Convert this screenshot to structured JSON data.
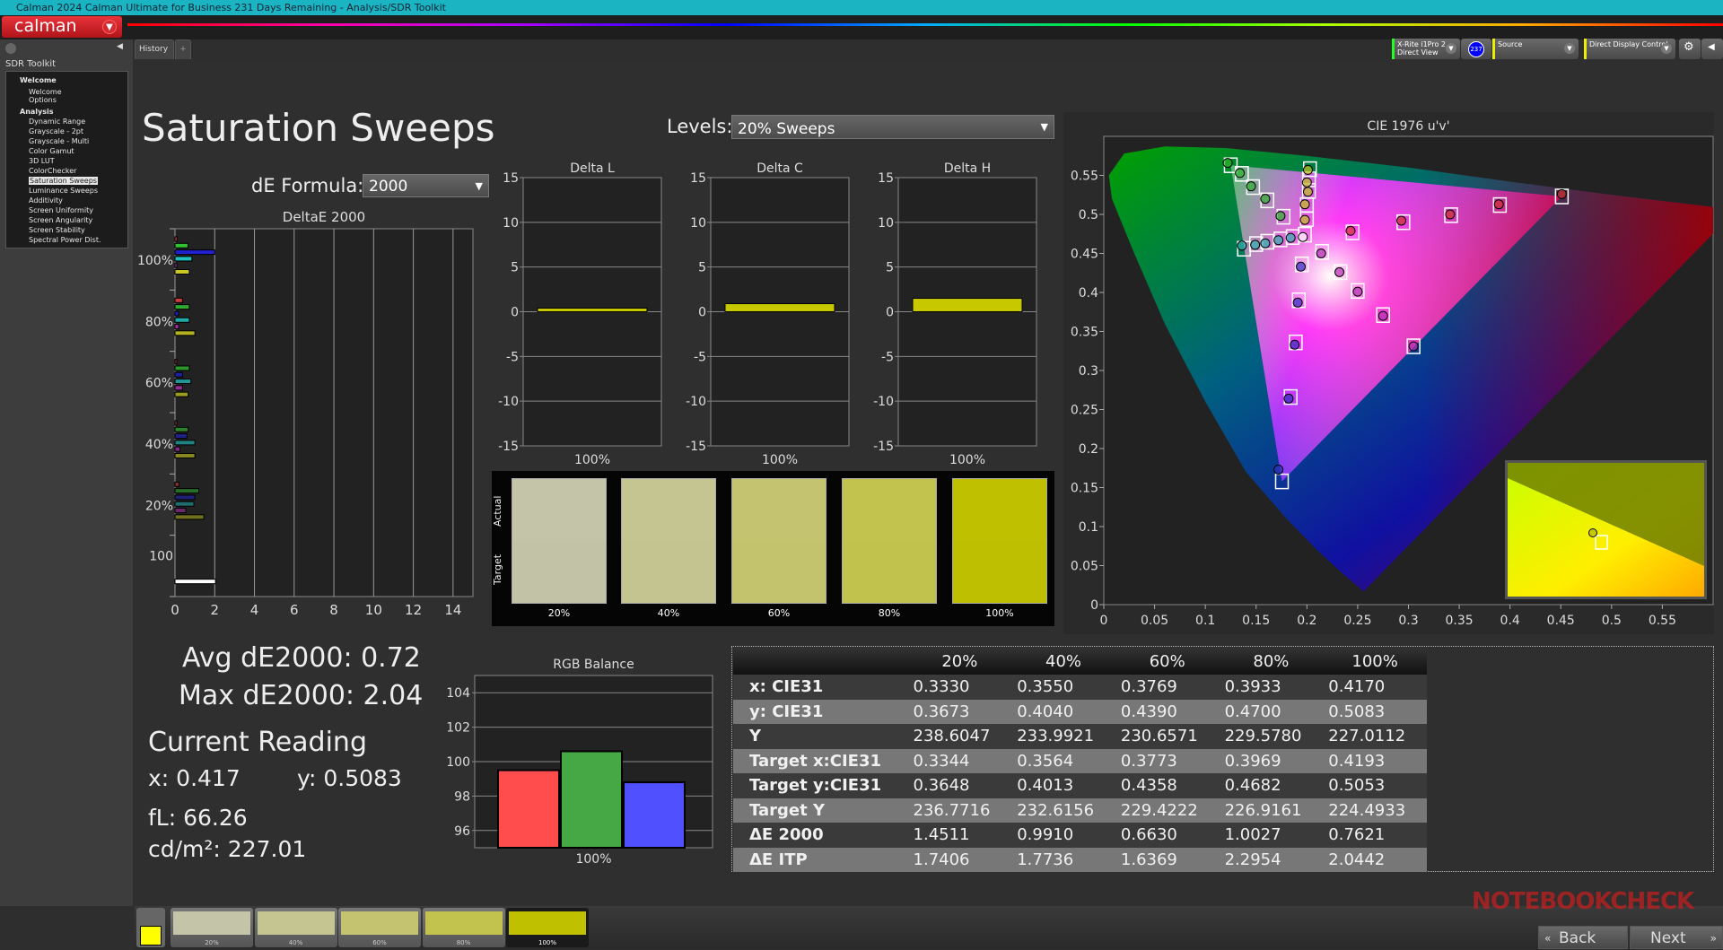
{
  "window": {
    "title": "Calman 2024 Calman Ultimate for Business 231 Days Remaining  - Analysis/SDR Toolkit",
    "logo": "calman"
  },
  "sidebar": {
    "title": "SDR Toolkit",
    "items": [
      {
        "label": "Welcome",
        "group": true
      },
      {
        "label": "Welcome"
      },
      {
        "label": "Options"
      },
      {
        "label": "Analysis",
        "group": true
      },
      {
        "label": "Dynamic Range"
      },
      {
        "label": "Grayscale - 2pt"
      },
      {
        "label": "Grayscale - Multi"
      },
      {
        "label": "Color Gamut"
      },
      {
        "label": "3D LUT"
      },
      {
        "label": "ColorChecker"
      },
      {
        "label": "Saturation Sweeps",
        "selected": true
      },
      {
        "label": "Luminance Sweeps"
      },
      {
        "label": "Additivity"
      },
      {
        "label": "Screen Uniformity"
      },
      {
        "label": "Screen Angularity"
      },
      {
        "label": "Screen Stability"
      },
      {
        "label": "Spectral Power Dist."
      }
    ]
  },
  "tabs": [
    {
      "label": "History 1"
    },
    {
      "label": "+"
    }
  ],
  "devices": {
    "meter_line1": "X-Rite i1Pro 2",
    "meter_line2": "Direct View",
    "meter_badge": "237",
    "source": "Source",
    "display": "Direct Display Control"
  },
  "page": {
    "title": "Saturation Sweeps",
    "de_formula_label": "dE Formula:",
    "de_formula_value": "2000",
    "levels_label": "Levels:",
    "levels_value": "20% Sweeps"
  },
  "summary": {
    "avg": "Avg dE2000: 0.72",
    "max": "Max dE2000: 2.04",
    "current_reading": "Current Reading",
    "x": "x: 0.417",
    "y": "y: 0.5083",
    "fl": "fL: 66.26",
    "cdm2": "cd/m²: 227.01"
  },
  "swatches": {
    "actual_label": "Actual",
    "target_label": "Target",
    "items": [
      {
        "label": "20%",
        "actual": "#c3c4a8",
        "target": "#c2c3a6"
      },
      {
        "label": "40%",
        "actual": "#c4c591",
        "target": "#c3c48f"
      },
      {
        "label": "60%",
        "actual": "#c4c470",
        "target": "#c3c36e"
      },
      {
        "label": "80%",
        "actual": "#c2c24f",
        "target": "#c1c14d"
      },
      {
        "label": "100%",
        "actual": "#bfc000",
        "target": "#bebf00"
      }
    ]
  },
  "table": {
    "columns": [
      "20%",
      "40%",
      "60%",
      "80%",
      "100%"
    ],
    "rows": [
      {
        "label": "x: CIE31",
        "values": [
          "0.3330",
          "0.3550",
          "0.3769",
          "0.3933",
          "0.4170"
        ]
      },
      {
        "label": "y: CIE31",
        "values": [
          "0.3673",
          "0.4040",
          "0.4390",
          "0.4700",
          "0.5083"
        ]
      },
      {
        "label": "Y",
        "values": [
          "238.6047",
          "233.9921",
          "230.6571",
          "229.5780",
          "227.0112"
        ]
      },
      {
        "label": "Target x:CIE31",
        "values": [
          "0.3344",
          "0.3564",
          "0.3773",
          "0.3969",
          "0.4193"
        ]
      },
      {
        "label": "Target y:CIE31",
        "values": [
          "0.3648",
          "0.4013",
          "0.4358",
          "0.4682",
          "0.5053"
        ]
      },
      {
        "label": "Target Y",
        "values": [
          "236.7716",
          "232.6156",
          "229.4222",
          "226.9161",
          "224.4933"
        ]
      },
      {
        "label": "ΔE 2000",
        "values": [
          "1.4511",
          "0.9910",
          "0.6630",
          "1.0027",
          "0.7621"
        ]
      },
      {
        "label": "ΔE ITP",
        "values": [
          "1.7406",
          "1.7736",
          "1.6369",
          "2.2954",
          "2.0442"
        ]
      }
    ]
  },
  "bottom": {
    "thumbs": [
      {
        "label": "20%",
        "color": "#c3c4a8"
      },
      {
        "label": "40%",
        "color": "#c4c591"
      },
      {
        "label": "60%",
        "color": "#c4c470"
      },
      {
        "label": "80%",
        "color": "#c2c24f"
      },
      {
        "label": "100%",
        "color": "#bfc000",
        "active": true
      }
    ],
    "current_color": "#ffff00",
    "back": "Back",
    "next": "Next",
    "watermark": "NOTEBOOKCHECK"
  },
  "chart_data": [
    {
      "type": "bar",
      "orientation": "horizontal",
      "title": "DeltaE 2000",
      "xlim": [
        0,
        15
      ],
      "xticks": [
        0,
        2,
        4,
        6,
        8,
        10,
        12,
        14
      ],
      "categories": [
        "100%",
        "80%",
        "60%",
        "40%",
        "20%",
        "100"
      ],
      "series_colors": {
        "red": "#e04040",
        "green": "#30c030",
        "blue": "#2020d0",
        "cyan": "#20c0c0",
        "magenta": "#c030c0",
        "yellow": "#c8c820",
        "white": "#ffffff"
      },
      "groups": [
        {
          "label": "100%",
          "values": {
            "red": 0.1,
            "green": 0.65,
            "blue": 2.0,
            "cyan": 0.85,
            "magenta": 0.08,
            "yellow": 0.72
          }
        },
        {
          "label": "80%",
          "values": {
            "red": 0.38,
            "green": 0.72,
            "blue": 0.18,
            "cyan": 0.72,
            "magenta": 0.18,
            "yellow": 1.0
          }
        },
        {
          "label": "60%",
          "values": {
            "red": 0.08,
            "green": 0.72,
            "blue": 0.38,
            "cyan": 0.8,
            "magenta": 0.38,
            "yellow": 0.66
          }
        },
        {
          "label": "40%",
          "values": {
            "red": 0.1,
            "green": 0.66,
            "blue": 0.6,
            "cyan": 1.0,
            "magenta": 0.25,
            "yellow": 1.0
          }
        },
        {
          "label": "20%",
          "values": {
            "red": 0.2,
            "green": 1.2,
            "blue": 1.0,
            "cyan": 0.95,
            "magenta": 0.55,
            "yellow": 1.45
          }
        },
        {
          "label": "100",
          "values": {
            "white": 2.04
          }
        }
      ]
    },
    {
      "type": "bar",
      "title": "Delta L",
      "categories": [
        "100%"
      ],
      "values": [
        0.3
      ],
      "ylim": [
        -15,
        15
      ],
      "yticks": [
        15,
        10,
        5,
        0,
        -5,
        -10,
        -15
      ],
      "color": "#c8c800"
    },
    {
      "type": "bar",
      "title": "Delta C",
      "categories": [
        "100%"
      ],
      "values": [
        0.8
      ],
      "ylim": [
        -15,
        15
      ],
      "yticks": [
        15,
        10,
        5,
        0,
        -5,
        -10,
        -15
      ],
      "color": "#c8c800"
    },
    {
      "type": "bar",
      "title": "Delta H",
      "categories": [
        "100%"
      ],
      "values": [
        1.4
      ],
      "ylim": [
        -15,
        15
      ],
      "yticks": [
        15,
        10,
        5,
        0,
        -5,
        -10,
        -15
      ],
      "color": "#c8c800"
    },
    {
      "type": "bar",
      "title": "RGB Balance",
      "categories": [
        "100%"
      ],
      "series": [
        {
          "values": [
            99.5
          ],
          "color": "#ff4d4d"
        },
        {
          "values": [
            100.6
          ],
          "color": "#45a845"
        },
        {
          "values": [
            98.8
          ],
          "color": "#5050ff"
        }
      ],
      "ylim": [
        95,
        105
      ],
      "yticks": [
        104,
        102,
        100,
        98,
        96
      ]
    },
    {
      "type": "scatter",
      "title": "CIE 1976 u'v'",
      "xlim": [
        0,
        0.6
      ],
      "ylim": [
        0,
        0.6
      ],
      "xticks": [
        0,
        0.05,
        0.1,
        0.15,
        0.2,
        0.25,
        0.3,
        0.35,
        0.4,
        0.45,
        0.5,
        0.55
      ],
      "yticks": [
        0,
        0.05,
        0.1,
        0.15,
        0.2,
        0.25,
        0.3,
        0.35,
        0.4,
        0.45,
        0.5,
        0.55
      ],
      "gamut": {
        "red": [
          0.451,
          0.523
        ],
        "green": [
          0.125,
          0.563
        ],
        "blue": [
          0.1754,
          0.1579
        ]
      },
      "measured": [
        {
          "color": "#d03030",
          "points": [
            [
              0.243,
              0.479
            ],
            [
              0.293,
              0.492
            ],
            [
              0.341,
              0.5
            ],
            [
              0.389,
              0.513
            ],
            [
              0.451,
              0.526
            ]
          ]
        },
        {
          "color": "#30b030",
          "points": [
            [
              0.174,
              0.498
            ],
            [
              0.159,
              0.52
            ],
            [
              0.145,
              0.536
            ],
            [
              0.134,
              0.553
            ],
            [
              0.122,
              0.566
            ]
          ]
        },
        {
          "color": "#3030c0",
          "points": [
            [
              0.194,
              0.433
            ],
            [
              0.191,
              0.387
            ],
            [
              0.188,
              0.333
            ],
            [
              0.182,
              0.264
            ],
            [
              0.172,
              0.173
            ]
          ]
        },
        {
          "color": "#30b0b0",
          "points": [
            [
              0.184,
              0.47
            ],
            [
              0.172,
              0.467
            ],
            [
              0.159,
              0.463
            ],
            [
              0.149,
              0.461
            ],
            [
              0.136,
              0.46
            ]
          ]
        },
        {
          "color": "#b030b0",
          "points": [
            [
              0.214,
              0.45
            ],
            [
              0.232,
              0.426
            ],
            [
              0.25,
              0.401
            ],
            [
              0.275,
              0.37
            ],
            [
              0.305,
              0.331
            ]
          ]
        },
        {
          "color": "#c0c020",
          "points": [
            [
              0.198,
              0.493
            ],
            [
              0.198,
              0.513
            ],
            [
              0.201,
              0.529
            ],
            [
              0.2,
              0.541
            ],
            [
              0.201,
              0.557
            ]
          ]
        },
        {
          "color": "#ffffff",
          "points": [
            [
              0.196,
              0.471
            ]
          ]
        }
      ],
      "targets": [
        [
          0.245,
          0.477
        ],
        [
          0.295,
          0.49
        ],
        [
          0.342,
          0.499
        ],
        [
          0.39,
          0.512
        ],
        [
          0.451,
          0.523
        ],
        [
          0.177,
          0.497
        ],
        [
          0.161,
          0.518
        ],
        [
          0.147,
          0.535
        ],
        [
          0.136,
          0.552
        ],
        [
          0.125,
          0.563
        ],
        [
          0.195,
          0.436
        ],
        [
          0.192,
          0.39
        ],
        [
          0.189,
          0.336
        ],
        [
          0.184,
          0.266
        ],
        [
          0.1754,
          0.1579
        ],
        [
          0.186,
          0.471
        ],
        [
          0.174,
          0.468
        ],
        [
          0.161,
          0.465
        ],
        [
          0.15,
          0.462
        ],
        [
          0.138,
          0.456
        ],
        [
          0.215,
          0.452
        ],
        [
          0.233,
          0.426
        ],
        [
          0.25,
          0.402
        ],
        [
          0.275,
          0.371
        ],
        [
          0.305,
          0.331
        ],
        [
          0.2,
          0.494
        ],
        [
          0.2,
          0.512
        ],
        [
          0.202,
          0.53
        ],
        [
          0.202,
          0.545
        ],
        [
          0.203,
          0.558
        ],
        [
          0.198,
          0.474
        ]
      ]
    }
  ]
}
